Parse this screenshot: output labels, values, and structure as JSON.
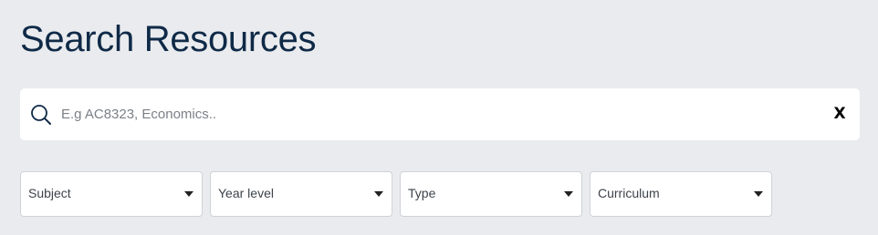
{
  "page": {
    "title": "Search Resources"
  },
  "search": {
    "placeholder": "E.g AC8323, Economics..",
    "value": "",
    "clear_label": "X"
  },
  "filters": [
    {
      "label": "Subject"
    },
    {
      "label": "Year level"
    },
    {
      "label": "Type"
    },
    {
      "label": "Curriculum"
    }
  ],
  "icons": {
    "search": "search-icon",
    "clear": "close-icon",
    "dropdown": "chevron-down-icon"
  },
  "colors": {
    "background": "#e9ebee",
    "title": "#0f2a47",
    "surface": "#ffffff"
  }
}
